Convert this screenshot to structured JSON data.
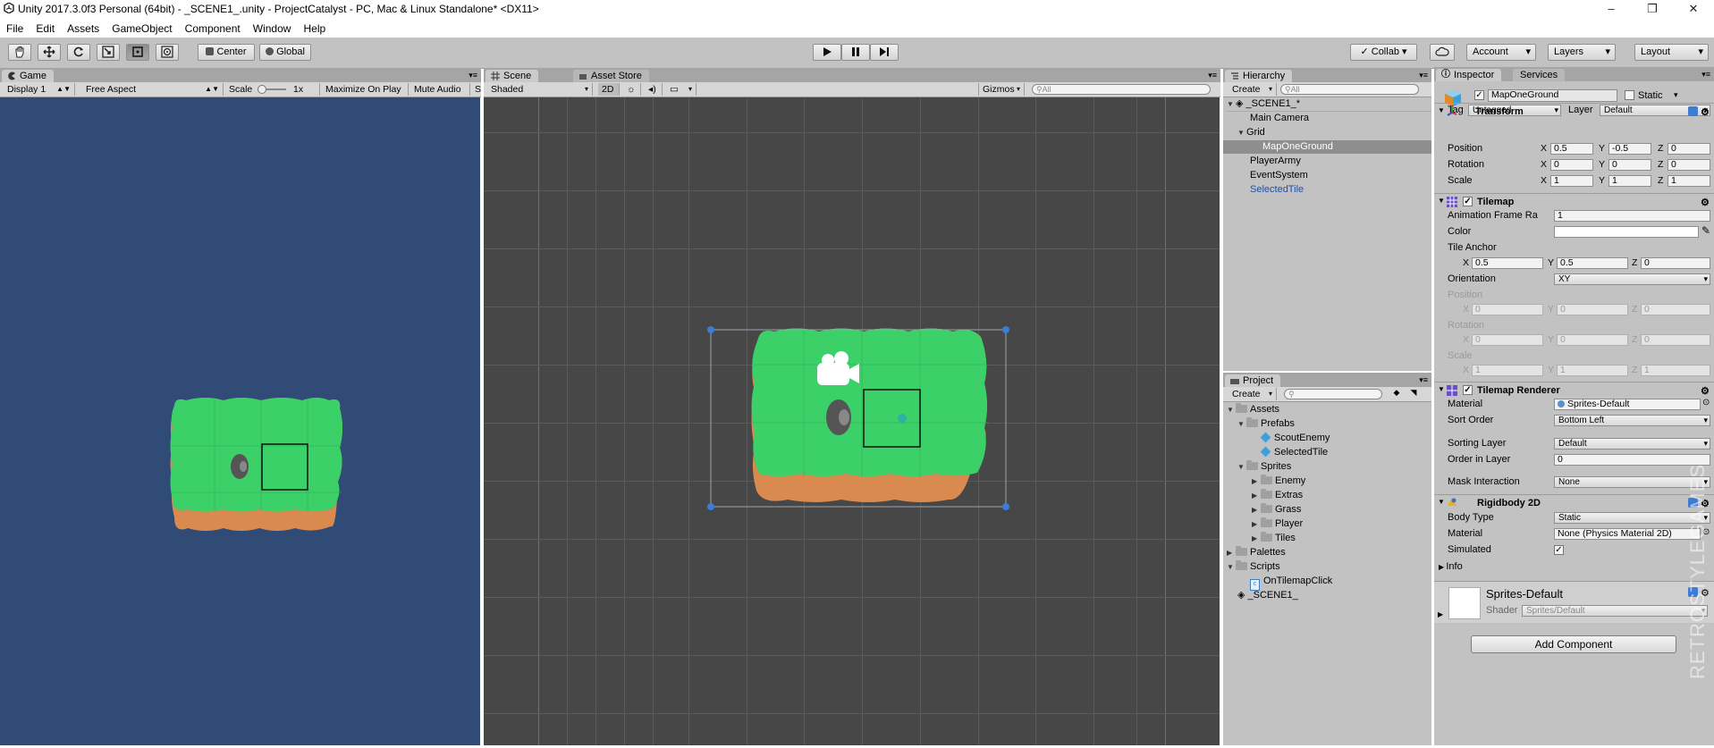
{
  "window": {
    "title": "Unity 2017.3.0f3 Personal (64bit) - _SCENE1_.unity - ProjectCatalyst - PC, Mac & Linux Standalone* <DX11>"
  },
  "menu": [
    "File",
    "Edit",
    "Assets",
    "GameObject",
    "Component",
    "Window",
    "Help"
  ],
  "toolbar": {
    "pivot": "Center",
    "space": "Global",
    "collab": "Collab",
    "account": "Account",
    "layers": "Layers",
    "layout": "Layout"
  },
  "game": {
    "tab": "Game",
    "display": "Display 1",
    "aspect": "Free Aspect",
    "scale_label": "Scale",
    "scale_value": "1x",
    "maximize": "Maximize On Play",
    "mute": "Mute Audio",
    "stats": "S"
  },
  "scene": {
    "tab": "Scene",
    "asset_store_tab": "Asset Store",
    "shading": "Shaded",
    "mode2d": "2D",
    "gizmos": "Gizmos",
    "search_placeholder": "All"
  },
  "hierarchy": {
    "tab": "Hierarchy",
    "create": "Create",
    "search_placeholder": "All",
    "scene": "_SCENE1_*",
    "items": [
      {
        "label": "Main Camera"
      },
      {
        "label": "Grid"
      },
      {
        "label": "MapOneGround"
      },
      {
        "label": "PlayerArmy"
      },
      {
        "label": "EventSystem"
      },
      {
        "label": "SelectedTile"
      }
    ]
  },
  "project": {
    "tab": "Project",
    "create": "Create",
    "items": [
      {
        "label": "Assets"
      },
      {
        "label": "Prefabs"
      },
      {
        "label": "ScoutEnemy"
      },
      {
        "label": "SelectedTile"
      },
      {
        "label": "Sprites"
      },
      {
        "label": "Enemy"
      },
      {
        "label": "Extras"
      },
      {
        "label": "Grass"
      },
      {
        "label": "Player"
      },
      {
        "label": "Tiles"
      },
      {
        "label": "Palettes"
      },
      {
        "label": "Scripts"
      },
      {
        "label": "OnTilemapClick"
      },
      {
        "label": "_SCENE1_"
      }
    ]
  },
  "inspector": {
    "tab": "Inspector",
    "services_tab": "Services",
    "object_name": "MapOneGround",
    "static_label": "Static",
    "tag_label": "Tag",
    "tag_value": "Untagged",
    "layer_label": "Layer",
    "layer_value": "Default",
    "transform": {
      "title": "Transform",
      "position_label": "Position",
      "position": [
        "0.5",
        "-0.5",
        "0"
      ],
      "rotation_label": "Rotation",
      "rotation": [
        "0",
        "0",
        "0"
      ],
      "scale_label": "Scale",
      "scale": [
        "1",
        "1",
        "1"
      ]
    },
    "tilemap": {
      "title": "Tilemap",
      "anim_label": "Animation Frame Ra",
      "anim_value": "1",
      "color_label": "Color",
      "anchor_label": "Tile Anchor",
      "anchor": [
        "0.5",
        "0.5",
        "0"
      ],
      "orientation_label": "Orientation",
      "orientation_value": "XY",
      "position_label": "Position",
      "position": [
        "0",
        "0",
        "0"
      ],
      "rotation_label": "Rotation",
      "rotation": [
        "0",
        "0",
        "0"
      ],
      "scale_label": "Scale",
      "scale": [
        "1",
        "1",
        "1"
      ]
    },
    "renderer": {
      "title": "Tilemap Renderer",
      "material_label": "Material",
      "material_value": "Sprites-Default",
      "sort_label": "Sort Order",
      "sort_value": "Bottom Left",
      "sorting_layer_label": "Sorting Layer",
      "sorting_layer_value": "Default",
      "order_label": "Order in Layer",
      "order_value": "0",
      "mask_label": "Mask Interaction",
      "mask_value": "None"
    },
    "rigidbody": {
      "title": "Rigidbody 2D",
      "body_type_label": "Body Type",
      "body_type_value": "Static",
      "material_label": "Material",
      "material_value": "None (Physics Material 2D)",
      "simulated_label": "Simulated",
      "info_label": "Info"
    },
    "material": {
      "name": "Sprites-Default",
      "shader_label": "Shader",
      "shader_value": "Sprites/Default"
    },
    "add_component": "Add Component"
  },
  "watermark": "RETROSTYLEGAMES",
  "colors": {
    "game_bg": "#2f4b76",
    "scene_bg": "#474747",
    "grass": "#3bd068",
    "dirt": "#d98a4f",
    "selection": "#3e7bd4"
  }
}
